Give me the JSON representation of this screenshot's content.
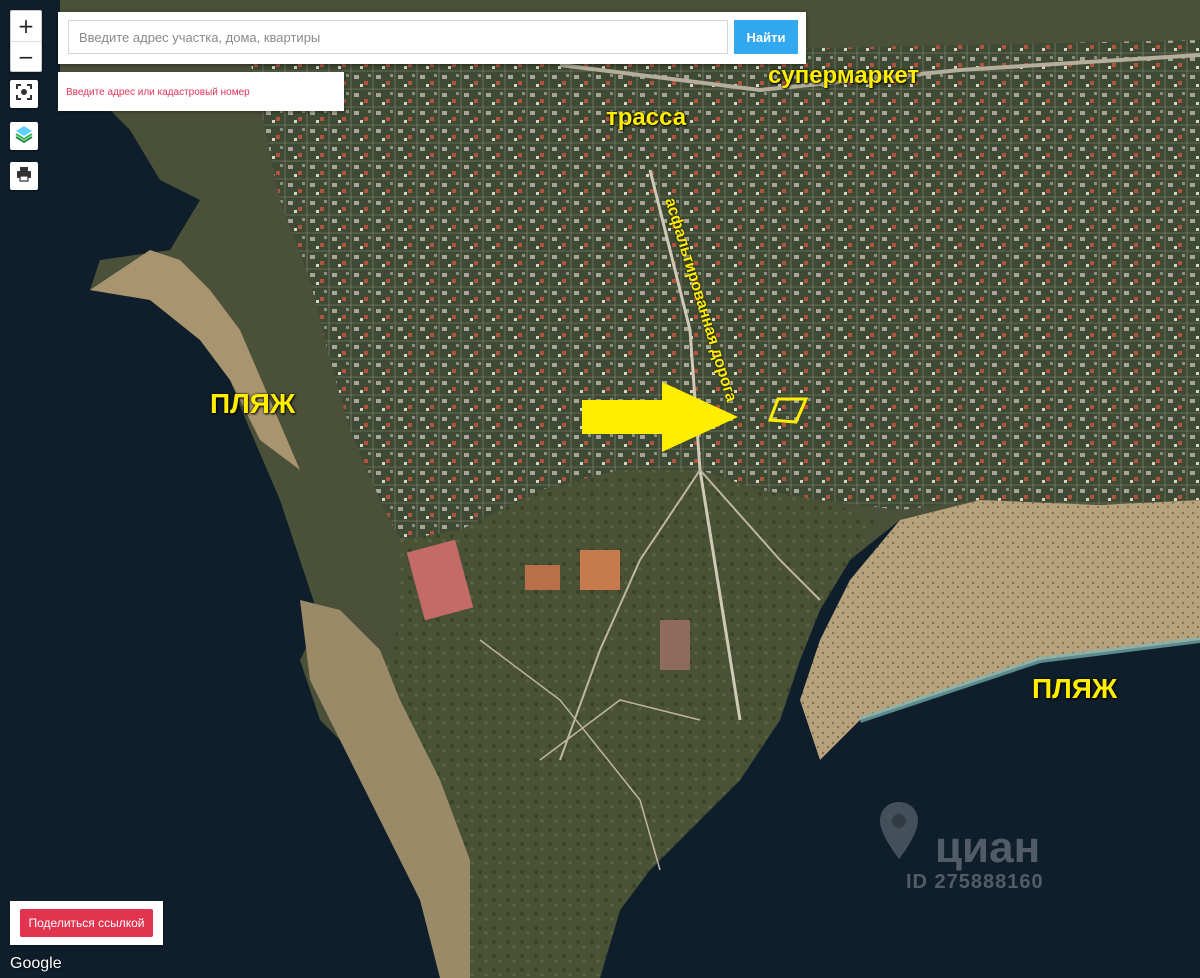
{
  "map": {
    "type": "satellite",
    "zoom_in_label": "+",
    "zoom_out_label": "−",
    "tools": [
      "fullscreen-icon",
      "layers-icon",
      "print-icon"
    ],
    "provider": "Google"
  },
  "search": {
    "placeholder": "Введите адрес участка, дома, квартиры",
    "button_label": "Найти",
    "button_color": "#32a8f0"
  },
  "cadastral": {
    "placeholder": "Введите адрес или кадастровый номер",
    "text_color": "#e0345a"
  },
  "annotations": {
    "color": "#ffee00",
    "supermarket": "супермаркет",
    "highway": "трасса",
    "paved_road": "асфальтированная дорога",
    "beach_west": "ПЛЯЖ",
    "beach_east": "ПЛЯЖ"
  },
  "share": {
    "label": "Поделиться ссылкой",
    "color": "#e2334f"
  },
  "watermark": {
    "brand": "циан",
    "id_text": "ID 275888160"
  }
}
